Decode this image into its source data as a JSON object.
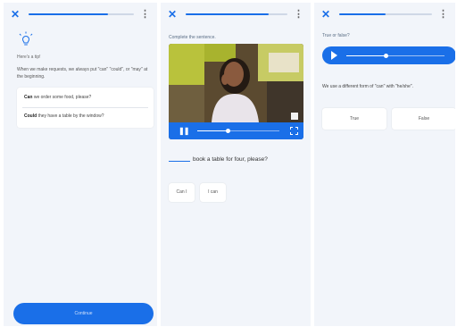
{
  "colors": {
    "accent": "#1a6fe8",
    "background": "#f2f5fa"
  },
  "screen1": {
    "progress": 0.75,
    "icons": {
      "close": "close-icon",
      "more": "more-vert-icon",
      "hint": "lightbulb-icon"
    },
    "title": "Here's a tip!",
    "body": "When we make requests, we always put \"can\" \"could\", or \"may\" at the beginning.",
    "examples": [
      {
        "bold": "Can",
        "rest": " we order some food, please?"
      },
      {
        "bold": "Could",
        "rest": " they have a table by the window?"
      }
    ],
    "continue_label": "Continue"
  },
  "screen2": {
    "progress": 0.82,
    "instruction": "Complete the sentence.",
    "video": {
      "position": 0.38,
      "icons": {
        "pause": "pause-icon",
        "fullscreen": "fullscreen-icon"
      }
    },
    "sentence": "book a table for four, please?",
    "options": [
      "Can I",
      "I can"
    ]
  },
  "screen3": {
    "progress": 0.5,
    "question": "True or false?",
    "audio": {
      "position": 0.4,
      "icon": "play-icon"
    },
    "statement": "We use a different form of \"can\" with \"he/she\".",
    "options": [
      "True",
      "False"
    ]
  }
}
